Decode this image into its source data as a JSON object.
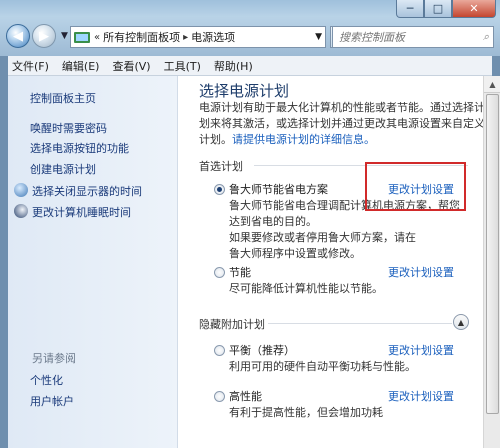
{
  "address": {
    "crumbs": [
      "所有控制面板项",
      "电源选项"
    ],
    "separator": "▸"
  },
  "search": {
    "placeholder": "搜索控制面板"
  },
  "window_controls": {
    "minimize": "─",
    "maximize": "□",
    "close": "✕"
  },
  "menu": [
    "文件(F)",
    "编辑(E)",
    "查看(V)",
    "工具(T)",
    "帮助(H)"
  ],
  "sidebar": {
    "home": "控制面板主页",
    "items": [
      {
        "label": "唤醒时需要密码",
        "icon": ""
      },
      {
        "label": "选择电源按钮的功能",
        "icon": ""
      },
      {
        "label": "创建电源计划",
        "icon": ""
      },
      {
        "label": "选择关闭显示器的时间",
        "icon": "monitor-icon"
      },
      {
        "label": "更改计算机睡眠时间",
        "icon": "sleep-moon-icon"
      }
    ],
    "see_also": "另请参阅",
    "see_also_items": [
      "个性化",
      "用户帐户"
    ]
  },
  "main": {
    "title": "选择电源计划",
    "description_lines": [
      "电源计划有助于最大化计算机的性能或者节能。通过选择计",
      "划来将其激活，或选择计划并通过更改其电源设置来自定义",
      "计划。"
    ],
    "more_info_link": "请提供电源计划的详细信息。",
    "preferred_header": "首选计划",
    "plans": [
      {
        "name": "鲁大师节能省电方案",
        "selected": true,
        "change_link": "更改计划设置",
        "description_lines": [
          "鲁大师节能省电合理调配计算机电源方案，帮您",
          "达到省电的目的。",
          "如果要修改或者停用鲁大师方案，请在",
          "鲁大师程序中设置或修改。"
        ]
      },
      {
        "name": "节能",
        "selected": false,
        "change_link": "更改计划设置",
        "description_lines": [
          "尽可能降低计算机性能以节能。"
        ]
      }
    ],
    "hidden_header": "隐藏附加计划",
    "hidden_plans": [
      {
        "name": "平衡（推荐）",
        "selected": false,
        "change_link": "更改计划设置",
        "description_lines": [
          "利用可用的硬件自动平衡功耗与性能。"
        ]
      },
      {
        "name": "高性能",
        "selected": false,
        "change_link": "更改计划设置",
        "description_lines": [
          "有利于提高性能，但会增加功耗"
        ]
      }
    ]
  },
  "colors": {
    "annotation_box": "#d12a2a",
    "link": "#1a5fbd",
    "title": "#1e3d6b"
  }
}
